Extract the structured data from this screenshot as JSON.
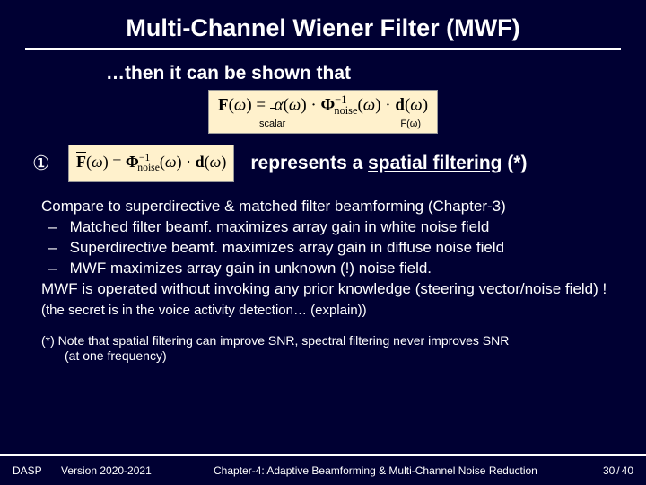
{
  "title": "Multi-Channel Wiener Filter (MWF)",
  "intro": "…then it can be shown that",
  "equation1": {
    "formula_html": "<b>F</b>(<i>ω</i>) = <span style='position:relative'><u style='text-decoration:none;border-bottom:1px solid #000;display:inline-block;line-height:0.3'>&nbsp;</u></span><i>α</i>(<i>ω</i>) · <b>Φ</b><sup>−1</sup><sub style='margin-left:-14px'>noise</sub>(<i>ω</i>) · <b>d</b>(<i>ω</i>)",
    "sub_left": "scalar",
    "sub_right": "F̄(ω)"
  },
  "bullet_marker": "①",
  "equation2_html": "<span class='bar'><b>F</b></span>(<i>ω</i>) = <b>Φ</b><sup>−1</sup><sub style='margin-left:-14px'>noise</sub>(<i>ω</i>) · <b>d</b>(<i>ω</i>)",
  "represents": {
    "prefix": "represents a ",
    "emph": "spatial filtering",
    "suffix": " (*)"
  },
  "body": {
    "line1": "Compare to superdirective & matched filter beamforming (Chapter-3)",
    "dash1": "Matched filter beamf. maximizes array gain in white noise field",
    "dash2": "Superdirective beamf. maximizes array gain in diffuse noise field",
    "dash3": "MWF maximizes array gain in unknown (!) noise field.",
    "line2a": "MWF is operated ",
    "line2u": "without invoking any prior knowledge",
    "line2b": " (steering vector/noise field) ! ",
    "secret": "(the secret is in the voice activity detection… (explain))"
  },
  "footnote": {
    "l1": "(*)  Note that spatial filtering can improve SNR, spectral filtering never improves SNR",
    "l2": "(at one frequency)"
  },
  "footer": {
    "dasp": "DASP",
    "version": "Version 2020-2021",
    "chapter": "Chapter-4: Adaptive Beamforming & Multi-Channel Noise Reduction",
    "page_cur": "30",
    "page_sep": "/",
    "page_tot": "40"
  }
}
